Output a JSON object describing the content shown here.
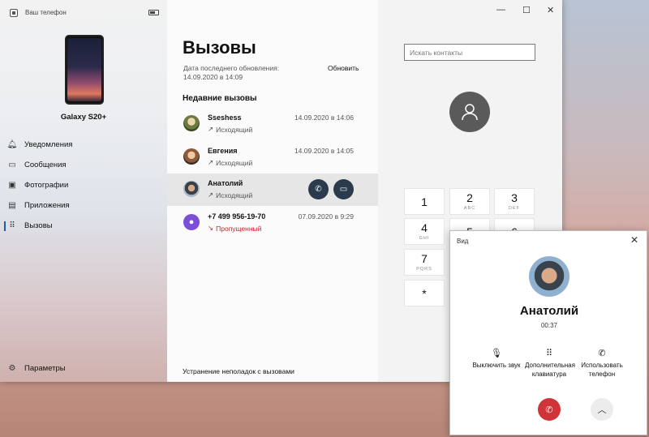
{
  "app": {
    "title": "Ваш телефон"
  },
  "device": {
    "name": "Galaxy S20+"
  },
  "nav": [
    {
      "label": "Уведомления",
      "icon": "bell-icon"
    },
    {
      "label": "Сообщения",
      "icon": "message-icon"
    },
    {
      "label": "Фотографии",
      "icon": "photo-icon"
    },
    {
      "label": "Приложения",
      "icon": "apps-icon"
    },
    {
      "label": "Вызовы",
      "icon": "dialpad-icon",
      "active": true
    }
  ],
  "settings": {
    "label": "Параметры"
  },
  "calls": {
    "title": "Вызовы",
    "updated": "Дата последнего обновления: 14.09.2020 в 14:09",
    "refresh": "Обновить",
    "recent_title": "Недавние вызовы",
    "items": [
      {
        "name": "Sseshess",
        "date": "14.09.2020 в 14:06",
        "type": "Исходящий"
      },
      {
        "name": "Евгения",
        "date": "14.09.2020 в 14:05",
        "type": "Исходящий"
      },
      {
        "name": "Анатолий",
        "date": "",
        "type": "Исходящий"
      },
      {
        "name": "+7 499 956-19-70",
        "date": "07.09.2020 в 9:29",
        "type": "Пропущенный"
      }
    ],
    "troubleshoot": "Устранение неполадок с вызовами"
  },
  "search": {
    "placeholder": "Искать контакты"
  },
  "dialpad": [
    {
      "digit": "1",
      "letters": ""
    },
    {
      "digit": "2",
      "letters": "ABC"
    },
    {
      "digit": "3",
      "letters": "DEF"
    },
    {
      "digit": "4",
      "letters": "GHI"
    },
    {
      "digit": "5",
      "letters": ""
    },
    {
      "digit": "6",
      "letters": ""
    },
    {
      "digit": "7",
      "letters": "PQRS"
    },
    {
      "digit": "*",
      "letters": ""
    }
  ],
  "popup": {
    "title": "Вид",
    "name": "Анатолий",
    "duration": "00:37",
    "actions": [
      {
        "label": "Выключить звук",
        "icon": "mic-off-icon"
      },
      {
        "label": "Дополнительная клавиатура",
        "icon": "keypad-icon"
      },
      {
        "label": "Использовать телефон",
        "icon": "phone-transfer-icon"
      }
    ]
  },
  "colors": {
    "accent": "#2b3a4d",
    "missed": "#c4262e",
    "hangup": "#d13438"
  }
}
